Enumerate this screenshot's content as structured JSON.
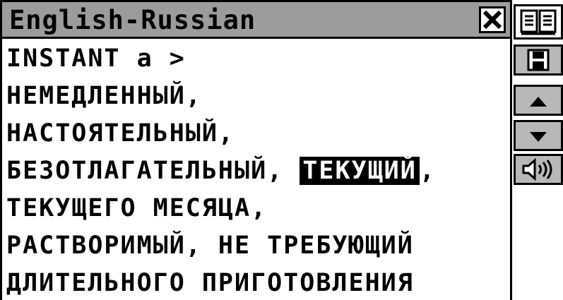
{
  "window": {
    "title": "English-Russian"
  },
  "entry": {
    "lines": [
      "INSTANT a >",
      "НЕМЕДЛЕННЫЙ,",
      "НАСТОЯТЕЛЬНЫЙ,",
      "БЕЗОТЛАГАТЕЛЬНЫЙ,",
      "ТЕКУЩЕГО МЕСЯЦА,",
      "РАСТВОРИМЫЙ, НЕ ТРЕБУЮЩИЙ",
      "ДЛИТЕЛЬНОГО ПРИГОТОВЛЕНИЯ"
    ],
    "highlighted_word": "ТЕКУЩИЙ",
    "after_highlight": ","
  },
  "toolbar": {
    "icons": [
      "book-icon",
      "save-icon",
      "scroll-up-icon",
      "scroll-down-icon",
      "speaker-icon"
    ]
  }
}
